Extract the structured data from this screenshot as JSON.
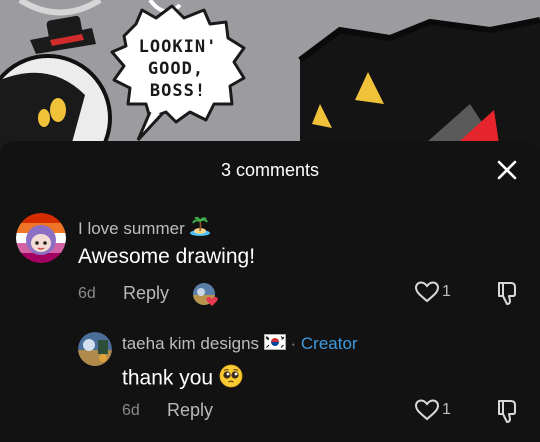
{
  "video": {
    "speech_bubble_lines": [
      "LOOKIN'",
      "GOOD,",
      "BOSS!"
    ]
  },
  "sheet": {
    "title": "3 comments",
    "close_icon": "close-icon"
  },
  "comments": [
    {
      "username": "I love summer",
      "username_emoji": "island-emoji-icon",
      "text": "Awesome drawing!",
      "time": "6d",
      "reply_label": "Reply",
      "likes": "1",
      "creator_liked": true
    },
    {
      "username": "taeha kim designs",
      "flag": "south-korea-flag-icon",
      "separator": "·",
      "badge": "Creator",
      "text": "thank you",
      "text_emoji": "pleading-face-emoji-icon",
      "time": "6d",
      "reply_label": "Reply",
      "likes": "1"
    }
  ],
  "colors": {
    "sheet_bg": "#121212",
    "creator_badge": "#3f9be0",
    "liked_heart": "#e8384f",
    "secondary_text": "#8a8a8a"
  }
}
